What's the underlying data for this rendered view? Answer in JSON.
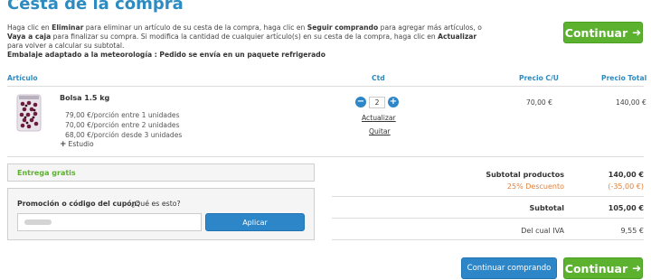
{
  "page": {
    "title": "Cesta de la compra"
  },
  "intro": {
    "p1": "Haga clic en ",
    "b1": "Eliminar",
    "p2": " para eliminar un artículo de su cesta de la compra, haga clic en ",
    "b2": "Seguir comprando",
    "p3": " para agregar más artículos, o ",
    "b3": "Vaya a caja",
    "p4": " para finalizar su compra. Si modifica la cantidad de cualquier artículo(s) en su cesta de la compra, haga clic en ",
    "b4": "Actualizar",
    "p5": " para volver a calcular su subtotal.",
    "note": "Embalaje adaptado a la meteorología : Pedido se envía en un paquete refrigerado"
  },
  "buttons": {
    "continue": "Continuar",
    "keep_shopping": "Continuar comprando",
    "apply": "Aplicar"
  },
  "table": {
    "headers": {
      "article": "Artículo",
      "qty": "Ctd",
      "unit_price": "Precio C/U",
      "total_price": "Precio Total"
    }
  },
  "item": {
    "name": "Bolsa 1.5 kg",
    "tiers": [
      "79,00 €/porción entre 1 unidades",
      "70,00 €/porción entre 2 unidades",
      "68,00 €/porción desde 3 unidades"
    ],
    "extra": "Estudio",
    "quantity": "2",
    "update_link": "Actualizar",
    "remove_link": "Quitar",
    "unit_price": "70,00 €",
    "total_price": "140,00 €"
  },
  "free_shipping": "Entrega gratis",
  "coupon": {
    "label": "Promoción o código del cupón:",
    "help": "¿Qué es esto?"
  },
  "summary": {
    "subtotal_products_label": "Subtotal productos",
    "subtotal_products_value": "140,00 €",
    "discount_label": "25% Descuento",
    "discount_value": "(-35,00 €)",
    "subtotal_label": "Subtotal",
    "subtotal_value": "105,00 €",
    "vat_label": "Del cual IVA",
    "vat_value": "9,55 €"
  },
  "colors": {
    "title_blue": "#2e8bc0",
    "button_green": "#5cb22f",
    "button_blue": "#2d86c7",
    "discount_orange": "#e0803a"
  }
}
